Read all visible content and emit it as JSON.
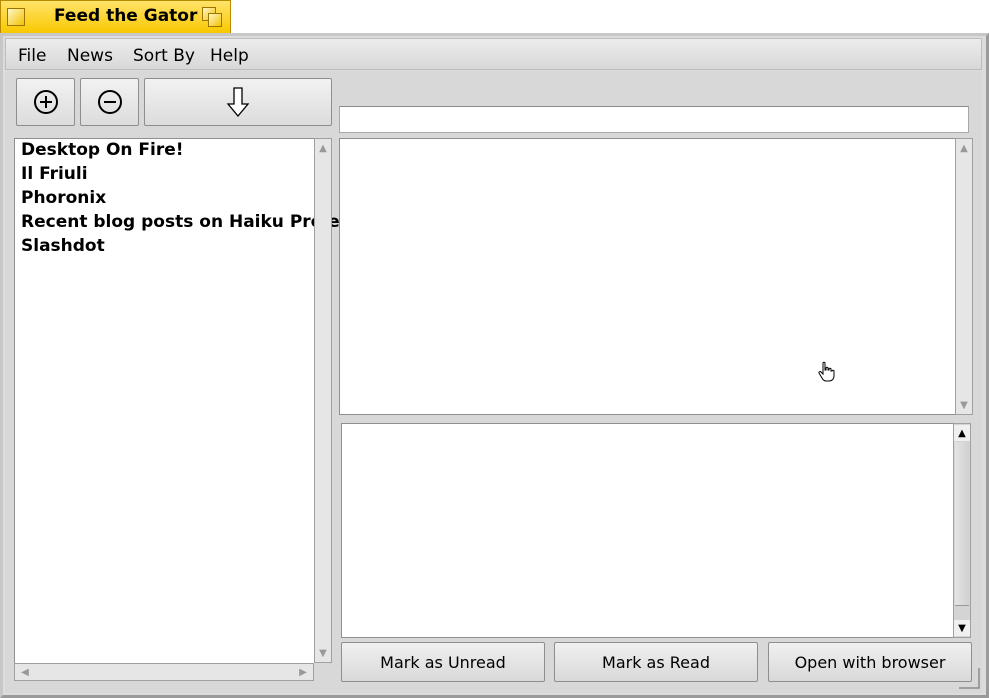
{
  "window": {
    "title": "Feed the Gator"
  },
  "menubar": {
    "items": [
      "File",
      "News",
      "Sort By",
      "Help"
    ]
  },
  "toolbar": {
    "add_icon": "circle-plus-icon",
    "remove_icon": "circle-minus-icon",
    "update_icon": "down-arrow-icon"
  },
  "url_field": {
    "value": ""
  },
  "feeds": {
    "items": [
      "Desktop On Fire!",
      "Il Friuli",
      "Phoronix",
      "Recent blog posts on Haiku Project",
      "Slashdot"
    ]
  },
  "actions": {
    "mark_unread": "Mark as Unread",
    "mark_read": "Mark as Read",
    "open_browser": "Open with browser"
  },
  "colors": {
    "tab_yellow": "#f9c800",
    "panel_gray": "#d8d8d8"
  }
}
